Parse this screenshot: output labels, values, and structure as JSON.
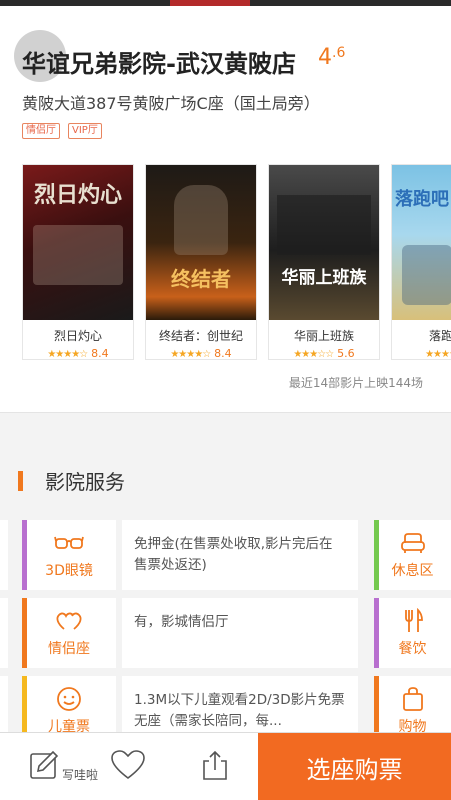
{
  "cinema": {
    "name": "华谊兄弟影院-武汉黄陂店",
    "score_int": "4",
    "score_dec": ".6",
    "address": "黄陂大道387号黄陂广场C座（国土局旁）",
    "tags": [
      "情侣厅",
      "VIP厅"
    ]
  },
  "movies": [
    {
      "title": "烈日灼心",
      "stars": "★★★★☆",
      "score": "8.4",
      "poster_text": "烈日灼心",
      "poster_colors": [
        "#5a1212",
        "#1a1a1a"
      ]
    },
    {
      "title": "终结者：创世纪",
      "stars": "★★★★☆",
      "score": "8.4",
      "poster_text": "终结者",
      "poster_colors": [
        "#2b1e10",
        "#d26a1c"
      ]
    },
    {
      "title": "华丽上班族",
      "stars": "★★★☆☆",
      "score": "5.6",
      "poster_text": "华丽上班族",
      "poster_colors": [
        "#2a2a2a",
        "#6b5a3a"
      ]
    },
    {
      "title": "落跑吧",
      "stars": "★★★★☆",
      "score": "",
      "poster_text": "落跑吧",
      "poster_colors": [
        "#6fb6d8",
        "#d9c27a"
      ]
    }
  ],
  "summary": "最近14部影片上映144场",
  "services": {
    "title": "影院服务",
    "rows": [
      {
        "label": "3D眼镜",
        "icon": "3d-glasses-icon",
        "desc": "免押金(在售票处收取,影片完后在售票处返还)",
        "edge_color": "#b86fcf",
        "right_label": "休息区",
        "right_icon": "sofa-icon",
        "right_edge": "#74c94e"
      },
      {
        "label": "情侣座",
        "icon": "couple-seat-icon",
        "desc": "有，影城情侣厅",
        "edge_color": "#f0781e",
        "right_label": "餐饮",
        "right_icon": "dining-icon",
        "right_edge": "#b86fcf"
      },
      {
        "label": "儿童票",
        "icon": "child-face-icon",
        "desc": "1.3M以下儿童观看2D/3D影片免票无座（需家长陪同，每...",
        "edge_color": "#f5b81e",
        "right_label": "购物",
        "right_icon": "shopping-bag-icon",
        "right_edge": "#f0781e"
      }
    ]
  },
  "bottom_bar": {
    "write_label": "写哇啦",
    "buy_label": "选座购票"
  },
  "colors": {
    "accent": "#f0781e",
    "buy_button": "#f26a21"
  }
}
